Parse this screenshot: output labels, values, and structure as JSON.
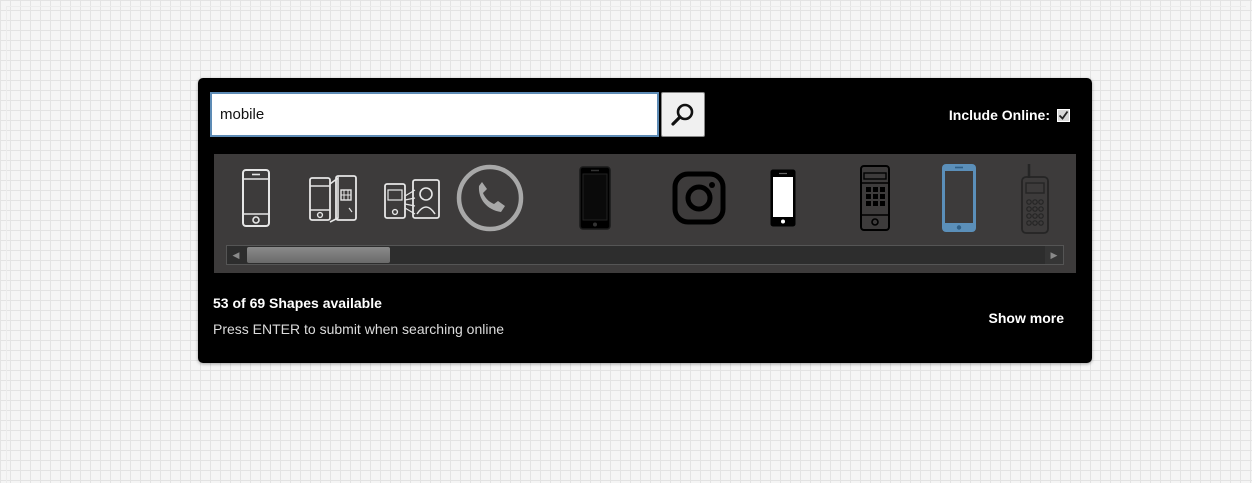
{
  "search": {
    "value": "mobile",
    "button_icon": "magnifier-icon"
  },
  "include_online": {
    "label": "Include Online:",
    "checked": true
  },
  "shapes": [
    {
      "icon": "smartphone-outline-icon"
    },
    {
      "icon": "phone-sim-card-icon"
    },
    {
      "icon": "mobile-contact-card-icon"
    },
    {
      "icon": "phone-call-circle-icon"
    },
    {
      "icon": "smartphone-black-icon"
    },
    {
      "icon": "instagram-camera-icon"
    },
    {
      "icon": "smartphone-white-icon"
    },
    {
      "icon": "keypad-phone-icon"
    },
    {
      "icon": "smartphone-blue-icon"
    },
    {
      "icon": "walkie-talkie-phone-icon"
    }
  ],
  "scrollbar": {
    "position_fraction": 0.0
  },
  "status": {
    "count_text": "53 of 69 Shapes available",
    "hint_text": "Press ENTER to submit when searching online",
    "show_more_label": "Show more"
  },
  "colors": {
    "panel_bg": "#000000",
    "strip_bg": "#3d3b3b",
    "input_border": "#5d8bb5",
    "accent_blue": "#5b8fb9"
  }
}
